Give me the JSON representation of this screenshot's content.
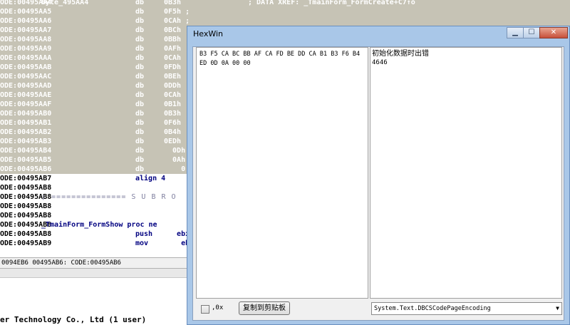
{
  "ida": {
    "lines": [
      {
        "addr": "ODE:00495AA4",
        "label": "byte_495AA4",
        "mn": "db",
        "op": "0B3h",
        "comment": "; DATA XREF: _TmainForm_FormCreate+C7↑o"
      },
      {
        "addr": "ODE:00495AA5",
        "label": "",
        "mn": "db",
        "op": "0F5h ;",
        "comment": ""
      },
      {
        "addr": "ODE:00495AA6",
        "label": "",
        "mn": "db",
        "op": "0CAh ;",
        "comment": ""
      },
      {
        "addr": "ODE:00495AA7",
        "label": "",
        "mn": "db",
        "op": "0BCh ;",
        "comment": ""
      },
      {
        "addr": "ODE:00495AA8",
        "label": "",
        "mn": "db",
        "op": "0BBh ;",
        "comment": ""
      },
      {
        "addr": "ODE:00495AA9",
        "label": "",
        "mn": "db",
        "op": "0AFh ;",
        "comment": ""
      },
      {
        "addr": "ODE:00495AAA",
        "label": "",
        "mn": "db",
        "op": "0CAh ;",
        "comment": ""
      },
      {
        "addr": "ODE:00495AAB",
        "label": "",
        "mn": "db",
        "op": "0FDh ;",
        "comment": ""
      },
      {
        "addr": "ODE:00495AAC",
        "label": "",
        "mn": "db",
        "op": "0BEh ;",
        "comment": ""
      },
      {
        "addr": "ODE:00495AAD",
        "label": "",
        "mn": "db",
        "op": "0DDh ;",
        "comment": ""
      },
      {
        "addr": "ODE:00495AAE",
        "label": "",
        "mn": "db",
        "op": "0CAh ;",
        "comment": ""
      },
      {
        "addr": "ODE:00495AAF",
        "label": "",
        "mn": "db",
        "op": "0B1h ;",
        "comment": ""
      },
      {
        "addr": "ODE:00495AB0",
        "label": "",
        "mn": "db",
        "op": "0B3h ;",
        "comment": ""
      },
      {
        "addr": "ODE:00495AB1",
        "label": "",
        "mn": "db",
        "op": "0F6h ;",
        "comment": ""
      },
      {
        "addr": "ODE:00495AB2",
        "label": "",
        "mn": "db",
        "op": "0B4h ;",
        "comment": ""
      },
      {
        "addr": "ODE:00495AB3",
        "label": "",
        "mn": "db",
        "op": "0EDh ;",
        "comment": ""
      },
      {
        "addr": "ODE:00495AB4",
        "label": "",
        "mn": "db",
        "op": "  0Dh",
        "comment": ""
      },
      {
        "addr": "ODE:00495AB5",
        "label": "",
        "mn": "db",
        "op": "  0Ah",
        "comment": ""
      },
      {
        "addr": "ODE:00495AB6",
        "label": "",
        "mn": "db",
        "op": "    0",
        "comment": ""
      },
      {
        "addr": "ODE:00495AB7",
        "label": "",
        "mn": "align 4",
        "op": "",
        "comment": ""
      },
      {
        "addr": "ODE:00495AB8",
        "label": "",
        "mn": "",
        "op": "",
        "comment": ""
      },
      {
        "addr": "ODE:00495AB8",
        "label": "; =============== S U B R O",
        "mn": "",
        "op": "",
        "comment": ""
      },
      {
        "addr": "ODE:00495AB8",
        "label": "",
        "mn": "",
        "op": "",
        "comment": ""
      },
      {
        "addr": "ODE:00495AB8",
        "label": "",
        "mn": "",
        "op": "",
        "comment": ""
      },
      {
        "addr": "ODE:00495AB8",
        "label": "_TmainForm_FormShow proc ne",
        "mn": "",
        "op": "",
        "comment": ""
      },
      {
        "addr": "ODE:00495AB8",
        "label": "",
        "mn": "push",
        "op": "   ebx",
        "comment": ""
      },
      {
        "addr": "ODE:00495AB9",
        "label": "",
        "mn": "mov",
        "op": "    ebx",
        "comment": ""
      }
    ],
    "status": "0094EB6 00495AB6: CODE:00495AB6",
    "output": "er Technology Co., Ltd (1 user)"
  },
  "hexwin": {
    "title": "HexWin",
    "min_glyph": "▁",
    "max_glyph": "☐",
    "close_glyph": "✕",
    "hex_text": "B3 F5 CA BC BB AF CA FD BE DD CA B1 B3 F6 B4 ED 0D 0A 00 00",
    "text_line1": "初始化数据时出错",
    "text_line2": "4646",
    "checkbox_label": ",0x",
    "copy_button": "复制到剪贴板",
    "encoding": "System.Text.DBCSCodePageEncoding",
    "encoding_arrow": "▼"
  },
  "colors": {
    "selection": "#c6c3b5",
    "title_bg": "#a9c7e8",
    "close_red": "#c7503a"
  }
}
